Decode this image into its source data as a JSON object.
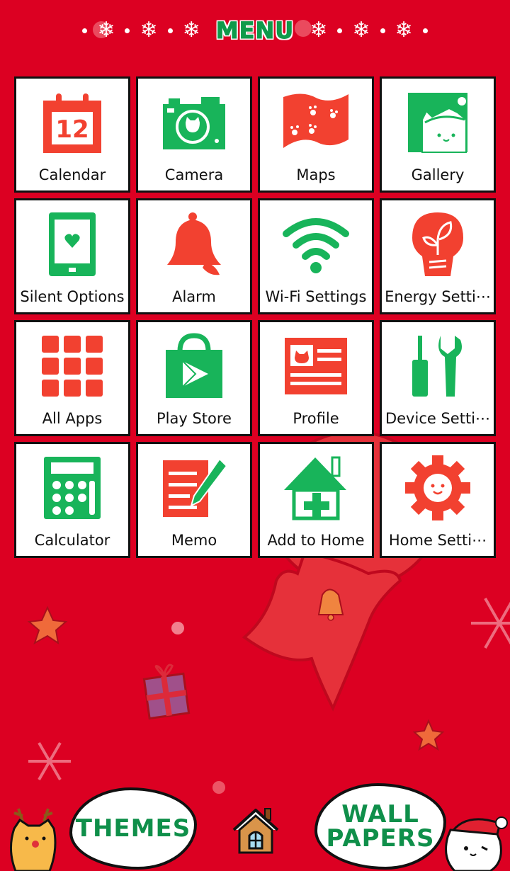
{
  "header": {
    "title": "MENU",
    "decor_icon": "snowflake-icon"
  },
  "apps": [
    {
      "label": "Calendar",
      "icon": "calendar-icon",
      "icon_text": "12",
      "color": "#f24130"
    },
    {
      "label": "Camera",
      "icon": "camera-icon",
      "color": "#18b45a"
    },
    {
      "label": "Maps",
      "icon": "map-flag-icon",
      "color": "#f24130"
    },
    {
      "label": "Gallery",
      "icon": "gallery-cat-icon",
      "color": "#18b45a"
    },
    {
      "label": "Silent Options",
      "icon": "phone-heart-icon",
      "color": "#18b45a"
    },
    {
      "label": "Alarm",
      "icon": "bell-icon",
      "color": "#f24130"
    },
    {
      "label": "Wi-Fi Settings",
      "icon": "wifi-icon",
      "color": "#18b45a"
    },
    {
      "label": "Energy Setti⋯",
      "icon": "lightbulb-leaf-icon",
      "color": "#f24130"
    },
    {
      "label": "All Apps",
      "icon": "grid-icon",
      "color": "#f24130"
    },
    {
      "label": "Play Store",
      "icon": "shopping-bag-play-icon",
      "color": "#18b45a"
    },
    {
      "label": "Profile",
      "icon": "profile-card-icon",
      "color": "#f24130"
    },
    {
      "label": "Device Setti⋯",
      "icon": "tools-icon",
      "color": "#18b45a"
    },
    {
      "label": "Calculator",
      "icon": "calculator-icon",
      "color": "#18b45a"
    },
    {
      "label": "Memo",
      "icon": "memo-pencil-icon",
      "color": "#f24130"
    },
    {
      "label": "Add to Home",
      "icon": "house-plus-icon",
      "color": "#18b45a"
    },
    {
      "label": "Home Setti⋯",
      "icon": "gear-face-icon",
      "color": "#f24130"
    }
  ],
  "bottom": {
    "themes_label": "THEMES",
    "wallpapers_label_line1": "WALL",
    "wallpapers_label_line2": "PAPERS",
    "home_icon": "house-icon"
  },
  "colors": {
    "background": "#dc0022",
    "accent_green": "#0f9a4a",
    "icon_red": "#f24130",
    "icon_green": "#18b45a"
  }
}
